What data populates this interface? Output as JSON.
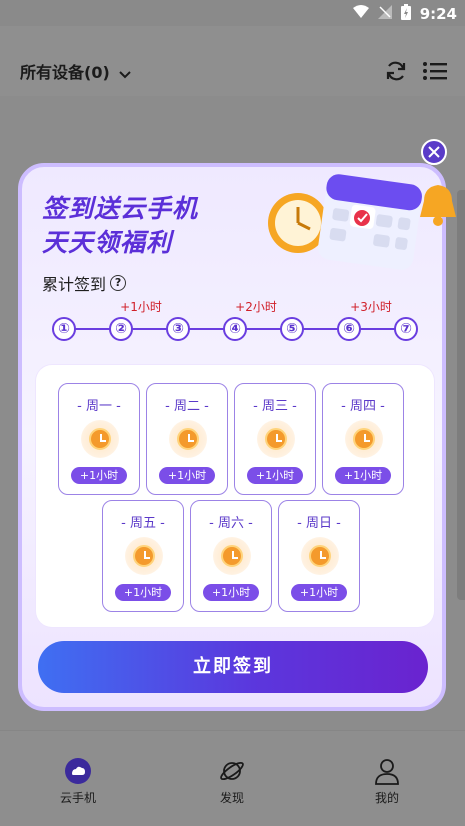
{
  "status_bar": {
    "time": "9:24"
  },
  "header": {
    "device_selector": "所有设备(0)"
  },
  "modal": {
    "title_line1": "签到送云手机",
    "title_line2": "天天领福利",
    "cumulative_label": "累计签到",
    "help_icon": "?",
    "steps": [
      "①",
      "②",
      "③",
      "④",
      "⑤",
      "⑥",
      "⑦"
    ],
    "step_rewards": [
      "+1小时",
      "+2小时",
      "+3小时"
    ],
    "days": [
      {
        "label": "- 周一 -",
        "reward": "+1小时"
      },
      {
        "label": "- 周二 -",
        "reward": "+1小时"
      },
      {
        "label": "- 周三 -",
        "reward": "+1小时"
      },
      {
        "label": "- 周四 -",
        "reward": "+1小时"
      },
      {
        "label": "- 周五 -",
        "reward": "+1小时"
      },
      {
        "label": "- 周六 -",
        "reward": "+1小时"
      },
      {
        "label": "- 周日 -",
        "reward": "+1小时"
      }
    ],
    "signin_button": "立即签到"
  },
  "bottom_nav": [
    {
      "label": "云手机",
      "icon": "cloud-phone-icon"
    },
    {
      "label": "发现",
      "icon": "planet-icon"
    },
    {
      "label": "我的",
      "icon": "user-icon"
    }
  ],
  "colors": {
    "accent": "#5b2fd8",
    "reward_red": "#d0202a",
    "button_start": "#3f6ff2",
    "button_end": "#6a23cf"
  }
}
